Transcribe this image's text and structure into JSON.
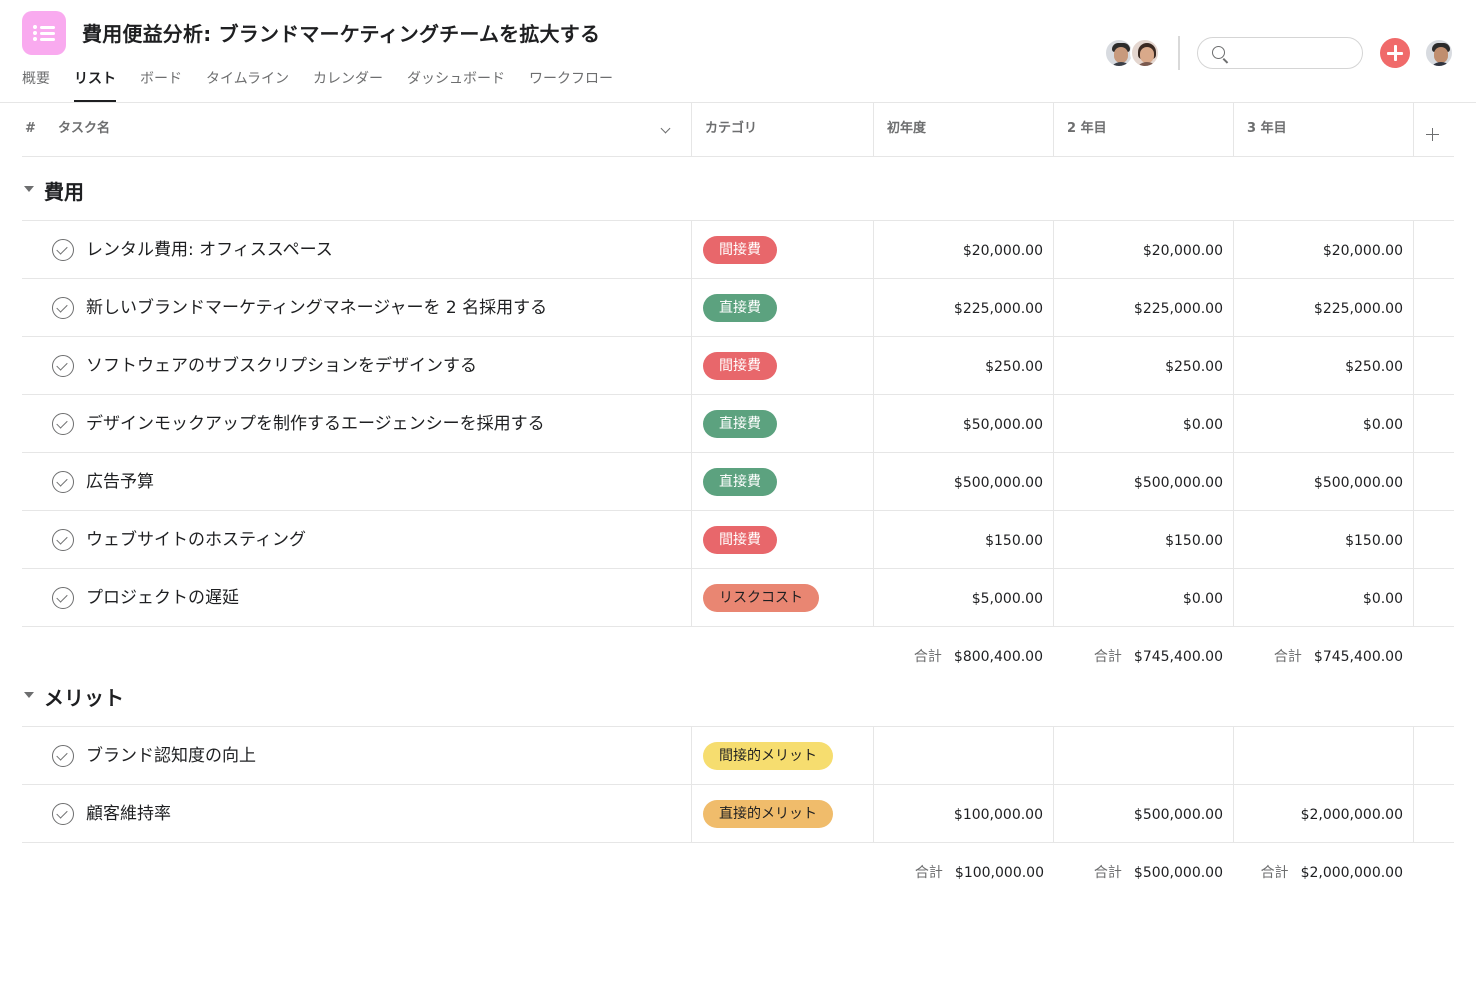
{
  "header": {
    "title": "費用便益分析: ブランドマーケティングチームを拡大する",
    "tabs": [
      "概要",
      "リスト",
      "ボード",
      "タイムライン",
      "カレンダー",
      "ダッシュボード",
      "ワークフロー"
    ],
    "active_tab": "リスト",
    "search_placeholder": ""
  },
  "columns": {
    "number": "#",
    "task_name": "タスク名",
    "category": "カテゴリ",
    "year1": "初年度",
    "year2": "2 年目",
    "year3": "3 年目"
  },
  "colors": {
    "accent": "#f06a6a",
    "app_icon": "#f9aaef",
    "indirect_cost": "#e8676b",
    "direct_cost": "#5ca27f",
    "risk_cost": "#e98672",
    "indirect_merit": "#f6dd6f",
    "direct_merit": "#f0bc6b"
  },
  "sections": [
    {
      "title": "費用",
      "rows": [
        {
          "name": "レンタル費用: オフィススペース",
          "category": "間接費",
          "y1": "$20,000.00",
          "y2": "$20,000.00",
          "y3": "$20,000.00"
        },
        {
          "name": "新しいブランドマーケティングマネージャーを 2 名採用する",
          "category": "直接費",
          "y1": "$225,000.00",
          "y2": "$225,000.00",
          "y3": "$225,000.00"
        },
        {
          "name": "ソフトウェアのサブスクリプションをデザインする",
          "category": "間接費",
          "y1": "$250.00",
          "y2": "$250.00",
          "y3": "$250.00"
        },
        {
          "name": "デザインモックアップを制作するエージェンシーを採用する",
          "category": "直接費",
          "y1": "$50,000.00",
          "y2": "$0.00",
          "y3": "$0.00"
        },
        {
          "name": "広告予算",
          "category": "直接費",
          "y1": "$500,000.00",
          "y2": "$500,000.00",
          "y3": "$500,000.00"
        },
        {
          "name": "ウェブサイトのホスティング",
          "category": "間接費",
          "y1": "$150.00",
          "y2": "$150.00",
          "y3": "$150.00"
        },
        {
          "name": "プロジェクトの遅延",
          "category": "リスクコスト",
          "y1": "$5,000.00",
          "y2": "$0.00",
          "y3": "$0.00"
        }
      ],
      "totals": {
        "label": "合計",
        "y1": "$800,400.00",
        "y2": "$745,400.00",
        "y3": "$745,400.00"
      }
    },
    {
      "title": "メリット",
      "rows": [
        {
          "name": "ブランド認知度の向上",
          "category": "間接的メリット",
          "y1": "",
          "y2": "",
          "y3": ""
        },
        {
          "name": "顧客維持率",
          "category": "直接的メリット",
          "y1": "$100,000.00",
          "y2": "$500,000.00",
          "y3": "$2,000,000.00"
        }
      ],
      "totals": {
        "label": "合計",
        "y1": "$100,000.00",
        "y2": "$500,000.00",
        "y3": "$2,000,000.00"
      }
    }
  ]
}
